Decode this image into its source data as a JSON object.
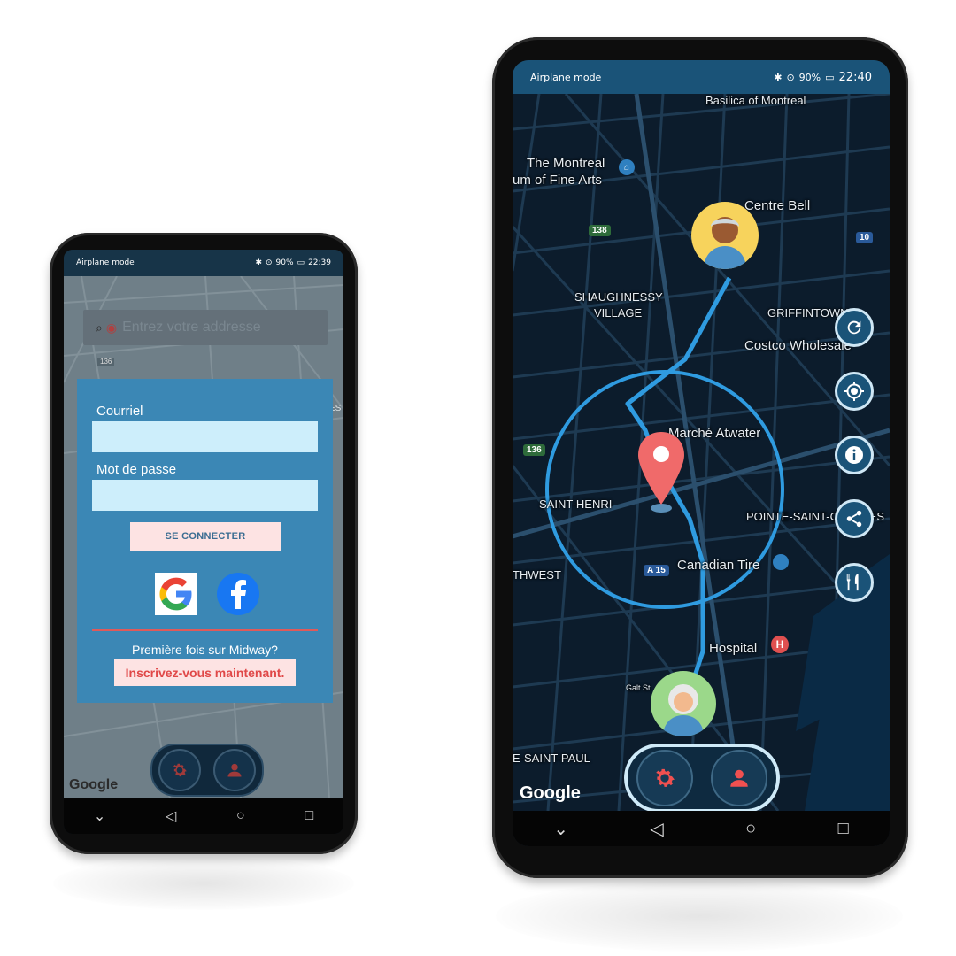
{
  "login_phone": {
    "status": {
      "left": "Airplane mode",
      "battery": "90%",
      "time": "22:39"
    },
    "search": {
      "placeholder": "Entrez votre addresse"
    },
    "form": {
      "email_label": "Courriel",
      "password_label": "Mot de passe",
      "login_button": "SE CONNECTER",
      "first_time": "Première fois sur Midway?",
      "signup_button": "Inscrivez-vous maintenant."
    },
    "map_labels": {
      "route_136": "136",
      "partial": "ES"
    },
    "google_logo": "Google"
  },
  "map_phone": {
    "status": {
      "left": "Airplane mode",
      "battery": "90%",
      "time": "22:40"
    },
    "map_labels": {
      "basilica": "Basilica of Montreal",
      "museum_line1": "The Montreal",
      "museum_line2": "um of Fine Arts",
      "centre_bell": "Centre Bell",
      "shaughnessy_line1": "SHAUGHNESSY",
      "shaughnessy_line2": "VILLAGE",
      "griffintown": "GRIFFINTOWN",
      "costco": "Costco Wholesale",
      "marche": "Marché Atwater",
      "saint_henri": "SAINT-HENRI",
      "pointe": "POINTE-SAINT-CHARLES",
      "canadian_tire": "Canadian Tire",
      "southwest": "THWEST",
      "hospital": "Hospital",
      "galt": "Galt St",
      "saint_paul": "E-SAINT-PAUL",
      "route_138": "138",
      "route_10": "10",
      "route_136": "136",
      "route_a15": "A 15"
    },
    "fabs": [
      "refresh-icon",
      "my-location-icon",
      "info-icon",
      "share-icon",
      "restaurant-icon"
    ],
    "google_logo": "Google"
  },
  "colors": {
    "card_blue": "#3b87b5",
    "field_bg": "#cdeefb",
    "button_bg": "#fde3e3",
    "accent_red": "#e04848",
    "route_blue": "#2f9be0",
    "map_bg": "#0c1c2c"
  }
}
